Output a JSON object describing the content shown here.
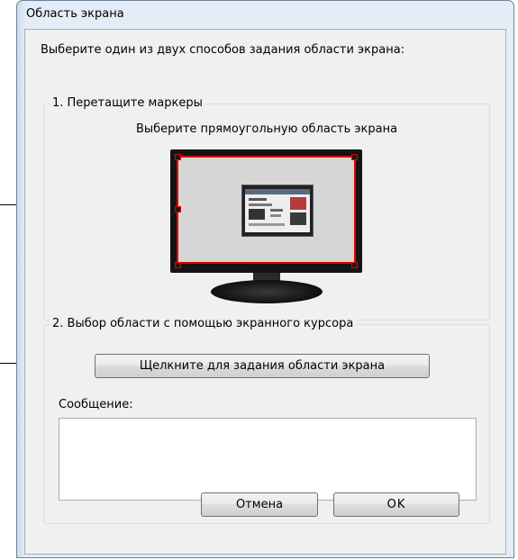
{
  "window": {
    "title": "Область экрана",
    "instruction": "Выберите один из двух способов задания области экрана:"
  },
  "group_drag": {
    "legend": "1. Перетащите маркеры",
    "subtitle": "Выберите прямоугольную область экрана"
  },
  "group_cursor": {
    "legend": "2. Выбор области с помощью экранного курсора",
    "select_button": "Щелкните для задания области экрана",
    "message_label": "Сообщение:",
    "message_text": ""
  },
  "buttons": {
    "cancel": "Отмена",
    "ok": "OK"
  },
  "colors": {
    "selection_border": "#e00000",
    "window_frame": "#dbe7f3",
    "client_bg": "#f0f0f0"
  }
}
